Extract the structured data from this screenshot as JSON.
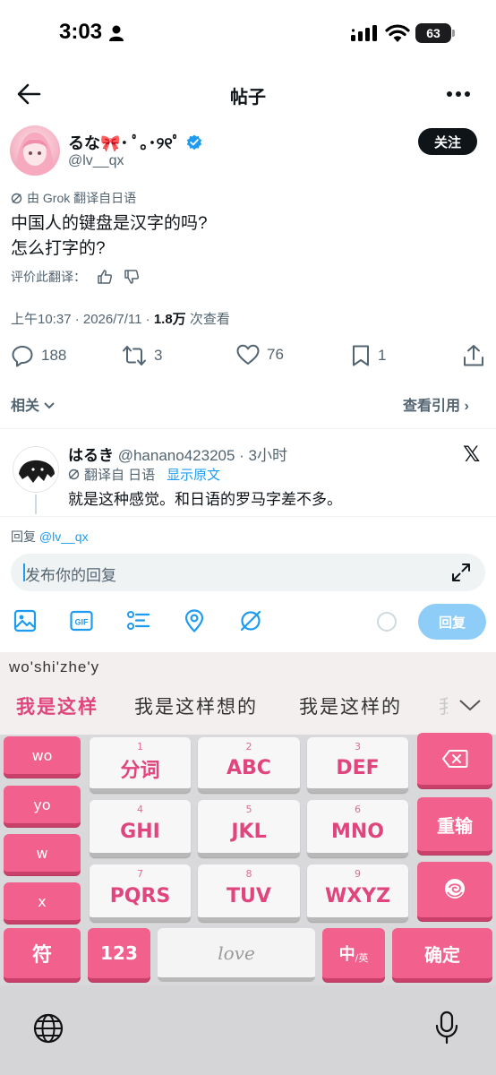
{
  "status_bar": {
    "time": "3:03",
    "battery": "63"
  },
  "nav": {
    "title": "帖子"
  },
  "post": {
    "author_name": "るな🎀･ ﾟ｡･୨୧ﾟ",
    "author_handle": "@lv__qx",
    "follow_label": "关注",
    "translation_note": "由 Grok 翻译自日语",
    "text_line1": "中国人的键盘是汉字的吗?",
    "text_line2": "怎么打字的?",
    "rate_translation": "评价此翻译：",
    "time": "上午10:37 · 2026/7/11 · ",
    "views": "1.8万",
    "views_suffix": " 次查看",
    "stats": {
      "replies": "188",
      "reposts": "3",
      "likes": "76",
      "bookmarks": "1"
    },
    "related_label": "相关",
    "quotes_label": "查看引用 ›"
  },
  "reply_preview": {
    "name": "はるき",
    "handle_time": " @hanano423205 · 3小时",
    "translated_from": "翻译自 日语",
    "show_original": "显示原文",
    "text": "就是这种感觉。和日语的罗马字差不多。"
  },
  "compose": {
    "reply_to_prefix": "回复 ",
    "reply_to_handle": "@lv__qx",
    "placeholder": "发布你的回复",
    "reply_button": "回复"
  },
  "keyboard": {
    "pinyin": "wo'shi'zhe'y",
    "candidates": [
      "我是这样",
      "我是这样想的",
      "我是这样的",
      "我"
    ],
    "left_keys": [
      "wo",
      "yo",
      "w",
      "x"
    ],
    "keys": [
      {
        "num": "1",
        "label": "分词"
      },
      {
        "num": "2",
        "label": "ABC"
      },
      {
        "num": "3",
        "label": "DEF"
      },
      {
        "num": "4",
        "label": "GHI"
      },
      {
        "num": "5",
        "label": "JKL"
      },
      {
        "num": "6",
        "label": "MNO"
      },
      {
        "num": "7",
        "label": "PQRS"
      },
      {
        "num": "8",
        "label": "TUV"
      },
      {
        "num": "9",
        "label": "WXYZ"
      }
    ],
    "retype": "重输",
    "symbols": "符",
    "numbers": "123",
    "space": "love",
    "lang_main": "中",
    "lang_sub": "/英",
    "confirm": "确定"
  }
}
